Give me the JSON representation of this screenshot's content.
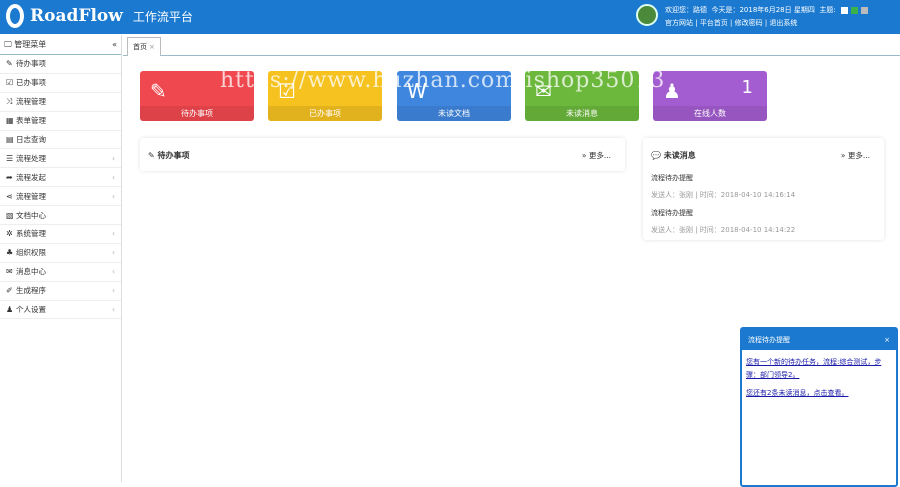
{
  "header": {
    "brand": "RoadFlow",
    "subtitle": "工作流平台",
    "welcome": "欢迎您：路德",
    "today": "今天是：2018年6月28日 星期四",
    "theme_label": "主题:",
    "links": [
      "官方网站",
      "平台首页",
      "修改密码",
      "退出系统"
    ],
    "theme_colors": [
      "#ffffff",
      "#3cb34a",
      "#bbbbbb"
    ]
  },
  "sidebar": {
    "title": "管理菜单",
    "collapse": "«",
    "items": [
      {
        "label": "待办事项",
        "icon": "✎",
        "sub": false
      },
      {
        "label": "已办事项",
        "icon": "☑",
        "sub": false
      },
      {
        "label": "流程管理",
        "icon": "⤨",
        "sub": false
      },
      {
        "label": "表单管理",
        "icon": "▦",
        "sub": false
      },
      {
        "label": "日志查询",
        "icon": "▤",
        "sub": false
      },
      {
        "label": "流程处理",
        "icon": "☰",
        "sub": true
      },
      {
        "label": "流程发起",
        "icon": "➦",
        "sub": true
      },
      {
        "label": "流程管理",
        "icon": "⋖",
        "sub": true
      },
      {
        "label": "文档中心",
        "icon": "▧",
        "sub": false
      },
      {
        "label": "系统管理",
        "icon": "✲",
        "sub": true
      },
      {
        "label": "组织权限",
        "icon": "♣",
        "sub": true
      },
      {
        "label": "消息中心",
        "icon": "✉",
        "sub": true
      },
      {
        "label": "生成程序",
        "icon": "✐",
        "sub": true
      },
      {
        "label": "个人设置",
        "icon": "♟",
        "sub": true
      }
    ]
  },
  "tab": {
    "label": "首页",
    "close": "×"
  },
  "cards": [
    {
      "label": "待办事项",
      "icon": "✎",
      "color": "#f0484f",
      "num": ""
    },
    {
      "label": "已办事项",
      "icon": "☑",
      "color": "#f5c220",
      "num": ""
    },
    {
      "label": "未读文档",
      "icon": "W",
      "color": "#3f86df",
      "num": ""
    },
    {
      "label": "未读消息",
      "icon": "✉",
      "color": "#6cb83c",
      "num": ""
    },
    {
      "label": "在线人数",
      "icon": "♟",
      "color": "#a35dd0",
      "num": "1"
    }
  ],
  "todo": {
    "title": "待办事项",
    "more": "» 更多..."
  },
  "messages": {
    "title": "未读消息",
    "more": "» 更多...",
    "items": [
      {
        "title": "流程待办提醒",
        "meta": "发送人：张刚 | 时间：2018-04-10 14:16:14"
      },
      {
        "title": "流程待办提醒",
        "meta": "发送人：张刚 | 时间：2018-04-10 14:14:22"
      }
    ]
  },
  "popup": {
    "title": "流程待办提醒",
    "close": "×",
    "lines": [
      "您有一个新的待办任务，流程:综合测试，步骤：部门领导2。",
      "您还有2条未读消息，点击查看。"
    ]
  },
  "watermark": "https://www.huzhan.com/ishop35013"
}
